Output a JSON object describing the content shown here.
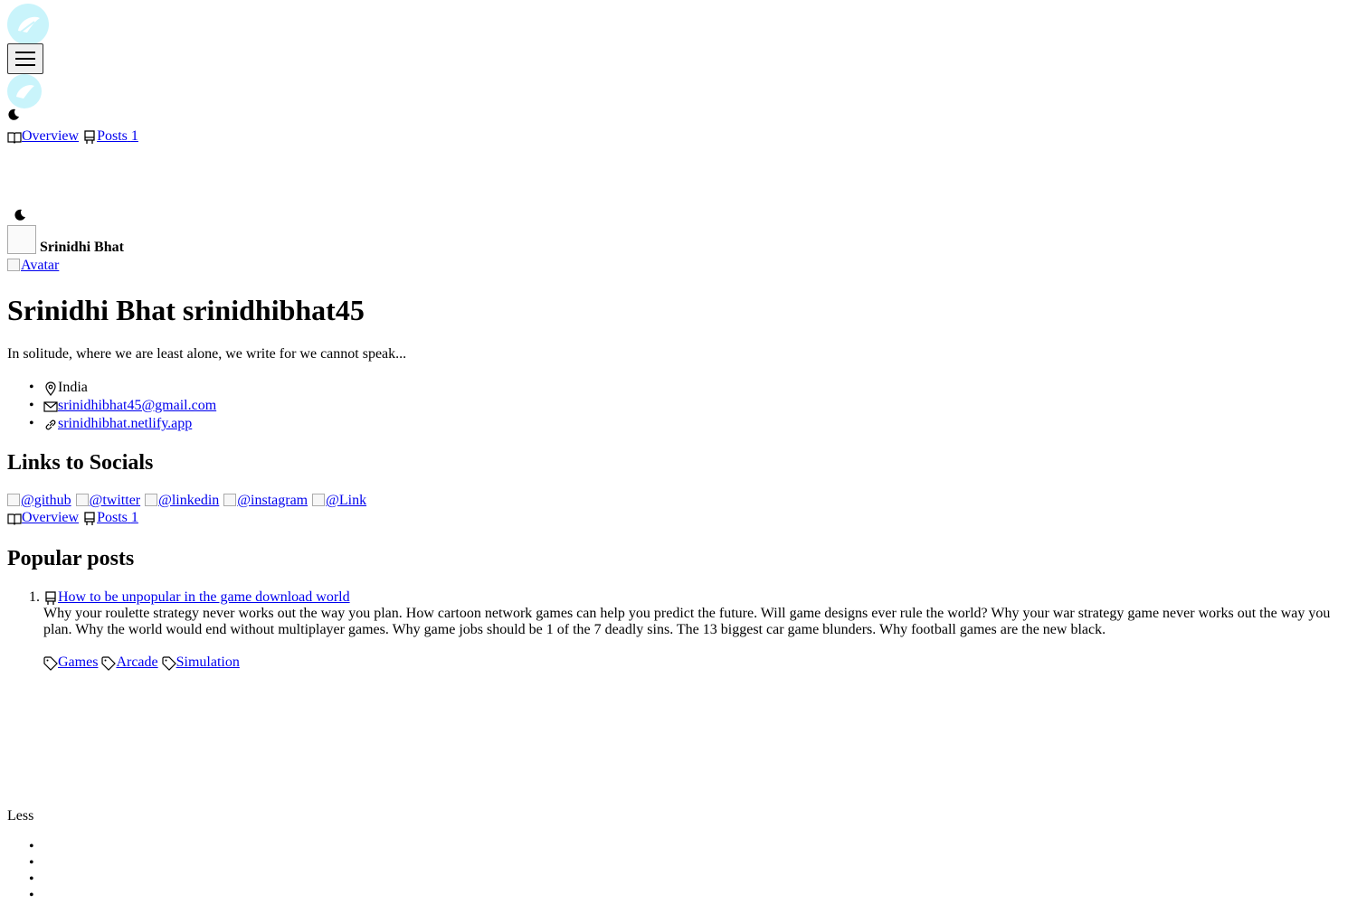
{
  "nav": {
    "overview_label": "Overview",
    "posts_label": "Posts",
    "posts_count": "1"
  },
  "header": {
    "name": "Srinidhi Bhat"
  },
  "profile": {
    "avatar_alt": "Avatar",
    "display_name": "Srinidhi Bhat",
    "username": "srinidhibhat45",
    "bio": "In solitude, where we are least alone, we write for we cannot speak...",
    "location": "India",
    "email": "srinidhibhat45@gmail.com",
    "website": "srinidhibhat.netlify.app"
  },
  "socials": {
    "heading": "Links to Socials",
    "links": [
      "@github",
      "@twitter",
      "@linkedin",
      "@instagram",
      "@Link"
    ]
  },
  "popular": {
    "heading": "Popular posts",
    "posts": [
      {
        "number": "1.",
        "title": "How to be unpopular in the game download world",
        "excerpt": "Why your roulette strategy never works out the way you plan. How cartoon network games can help you predict the future. Will game designs ever rule the world? Why your war strategy game never works out the way you plan. Why the world would end without multiplayer games. Why game jobs should be 1 of the 7 deadly sins. The 13 biggest car game blunders. Why football games are the new black.",
        "tags": [
          "Games",
          "Arcade",
          "Simulation"
        ]
      }
    ]
  },
  "footer": {
    "less_label": "Less"
  },
  "colors": {
    "link": "#0000ee",
    "logo_bg": "#c9f4fb"
  },
  "icons": [
    "logo-icon",
    "hamburger-icon",
    "moon-icon",
    "book-icon",
    "post-icon",
    "location-icon",
    "mail-icon",
    "link-icon",
    "tag-icon"
  ]
}
